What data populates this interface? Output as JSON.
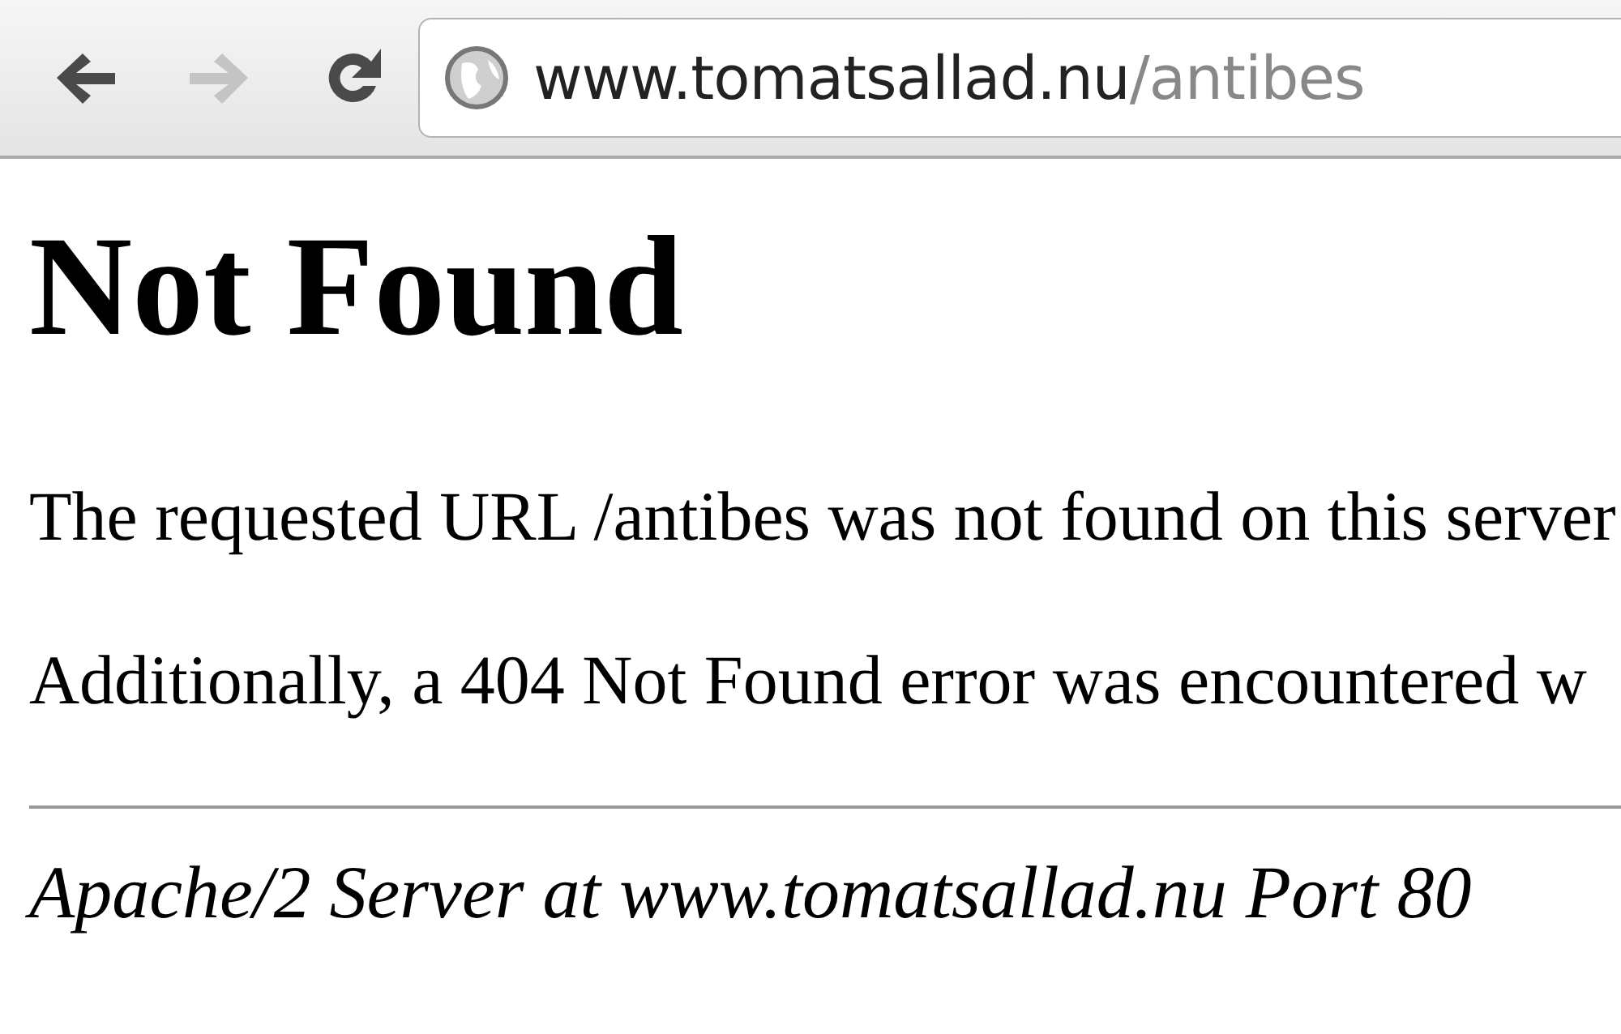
{
  "toolbar": {
    "buttons": [
      {
        "kind": "back",
        "disabled": false
      },
      {
        "kind": "forward",
        "disabled": true
      },
      {
        "kind": "reload",
        "disabled": false
      }
    ],
    "address": {
      "host": "www.tomatsallad.nu",
      "path": "/antibes"
    }
  },
  "page": {
    "heading": "Not Found",
    "paragraphs": [
      "The requested URL /antibes was not found on this server",
      "Additionally, a 404 Not Found error was encountered w"
    ],
    "footer": "Apache/2 Server at www.tomatsallad.nu Port 80"
  }
}
